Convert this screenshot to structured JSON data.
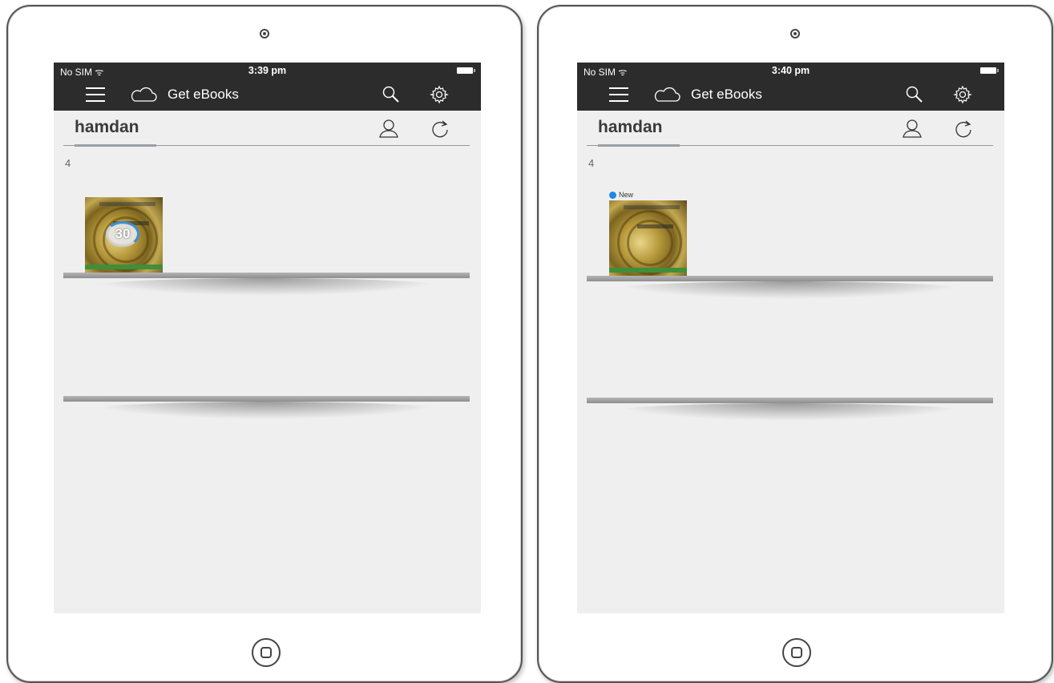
{
  "devices": [
    {
      "status": {
        "carrier": "No SIM",
        "time": "3:39 pm"
      },
      "toolbar": {
        "get_label": "Get eBooks"
      },
      "user": {
        "name": "hamdan"
      },
      "shelf": {
        "count": "4",
        "book_progress": "30"
      }
    },
    {
      "status": {
        "carrier": "No SIM",
        "time": "3:40 pm"
      },
      "toolbar": {
        "get_label": "Get eBooks"
      },
      "user": {
        "name": "hamdan"
      },
      "shelf": {
        "count": "4",
        "new_label": "New"
      }
    }
  ],
  "icons": {
    "menu": "hamburger-menu-icon",
    "cloud": "cloud-icon",
    "search": "search-icon",
    "settings": "gear-icon",
    "account": "user-icon",
    "sync": "refresh-icon"
  },
  "colors": {
    "toolbar": "#2c2c2c",
    "shelf_bg": "#efefef",
    "new_dot": "#1e88e5",
    "progress_ring": "#3b8ed8"
  }
}
